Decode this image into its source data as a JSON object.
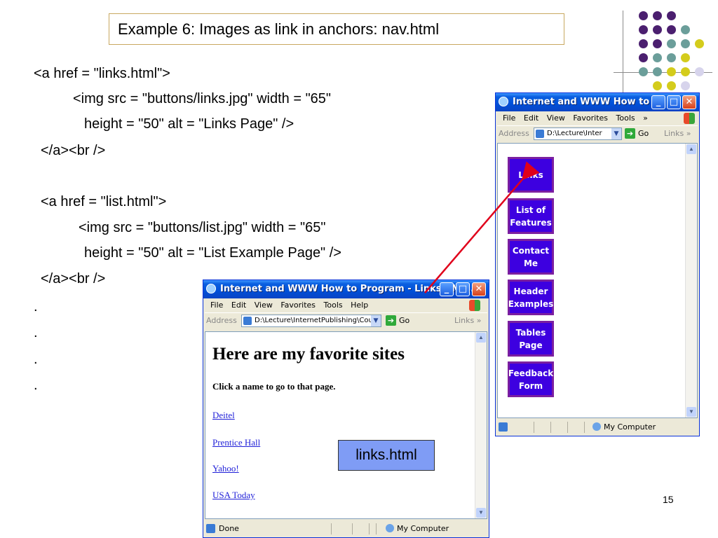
{
  "slide": {
    "title": "Example 6: Images as link in anchors: nav.html",
    "code_lines": [
      "<a href = \"links.html\">",
      "<img src = \"buttons/links.jpg\" width = \"65\"",
      "height = \"50\" alt = \"Links Page\" />",
      "</a><br />",
      "<a href = \"list.html\">",
      "<img src = \"buttons/list.jpg\" width = \"65\"",
      "height = \"50\" alt = \"List Example Page\" />",
      "</a><br />",
      ".",
      ".",
      ".",
      "."
    ],
    "callout": "links.html",
    "page_number": "15"
  },
  "nav_window": {
    "title": "Internet and WWW How to ...",
    "menu": [
      "File",
      "Edit",
      "View",
      "Favorites",
      "Tools",
      "»"
    ],
    "address_label": "Address",
    "address_value": "D:\\Lecture\\Inter",
    "go_label": "Go",
    "links_label": "Links »",
    "buttons": [
      "Links",
      "List of\nFeatures",
      "Contact\nMe",
      "Header\nExamples",
      "Tables\nPage",
      "Feedback\nForm"
    ],
    "status_zone": "My Computer"
  },
  "links_window": {
    "title": "Internet and WWW How to Program - Links - Mi...",
    "menu": [
      "File",
      "Edit",
      "View",
      "Favorites",
      "Tools",
      "Help"
    ],
    "address_label": "Address",
    "address_value": "D:\\Lecture\\InternetPublishing\\CourseMater",
    "go_label": "Go",
    "links_label": "Links »",
    "heading": "Here are my favorite sites",
    "subheading": "Click a name to go to that page.",
    "links": [
      "Deitel",
      "Prentice Hall",
      "Yahoo!",
      "USA Today"
    ],
    "status_text": "Done",
    "status_zone": "My Computer"
  },
  "colors": {
    "purple_dot": "#4b1f6f",
    "teal_dot": "#6b9e9a",
    "yellow_dot": "#d4cc1c",
    "lavender_dot": "#d7d4ec",
    "button_bg": "#3d00e0",
    "arrow": "#e0001b"
  },
  "icons": [
    "ie-icon",
    "minimize-icon",
    "maximize-icon",
    "close-icon",
    "windows-logo-icon",
    "go-arrow-icon",
    "my-computer-icon"
  ]
}
